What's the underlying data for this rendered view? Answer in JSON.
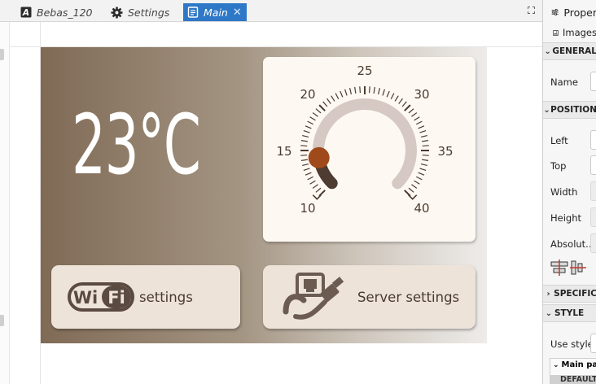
{
  "tabs": [
    {
      "label": "Bebas_120",
      "icon": "font-icon",
      "active": false
    },
    {
      "label": "Settings",
      "icon": "gear-icon",
      "active": false
    },
    {
      "label": "Main",
      "icon": "document-icon",
      "active": true
    }
  ],
  "screen": {
    "temperature": "23°C",
    "dial": {
      "min": 10,
      "max": 40,
      "value": 14,
      "tick_labels": [
        "10",
        "15",
        "20",
        "25",
        "30",
        "35",
        "40"
      ]
    },
    "wifi_button": {
      "icon_text_1": "Wi",
      "icon_text_2": "Fi",
      "label": "settings"
    },
    "server_button": {
      "label": "Server settings",
      "icon": "ethernet-cable-icon"
    }
  },
  "colors": {
    "accent": "#2e78c7",
    "gradient_start": "#7f6a55",
    "gradient_end": "#eeecea",
    "knob": "#a04a1c",
    "arc_active": "#4e3b31",
    "arc_track": "#d6c8c3",
    "button_bg": "#ede3d9"
  },
  "panel": {
    "title": "Proper",
    "image_item": "Images",
    "sections": {
      "general": "GENERAL",
      "position": "POSITION",
      "specific": "SPECIFIC",
      "style": "STYLE"
    },
    "fields": {
      "name": "Name",
      "left": "Left",
      "top": "Top",
      "width": "Width",
      "height": "Height",
      "absolute": "Absolut...",
      "use_style": "Use style"
    },
    "main_part": "Main par",
    "default_state": "DEFAULT"
  }
}
